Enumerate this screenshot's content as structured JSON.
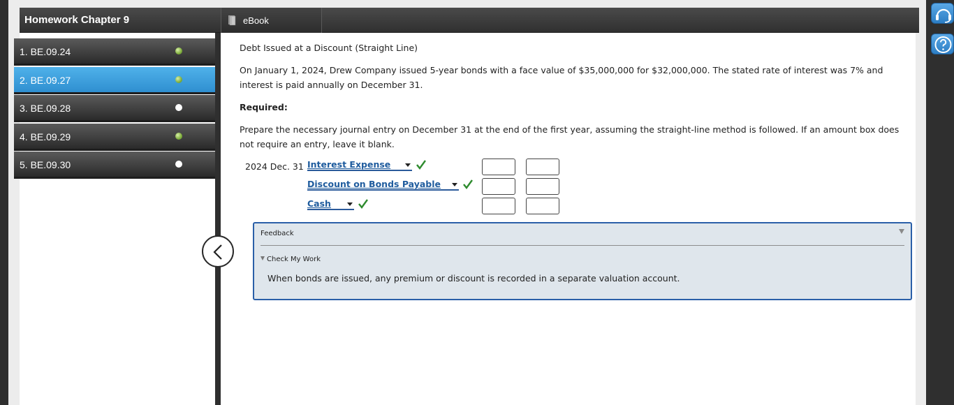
{
  "header": {
    "title": "Homework Chapter 9",
    "tab_ebook": "eBook"
  },
  "sidebar": {
    "items": [
      {
        "label": "1. BE.09.24",
        "status": "done"
      },
      {
        "label": "2. BE.09.27",
        "status": "done",
        "active": true
      },
      {
        "label": "3. BE.09.28",
        "status": "open"
      },
      {
        "label": "4. BE.09.29",
        "status": "done"
      },
      {
        "label": "5. BE.09.30",
        "status": "open"
      }
    ]
  },
  "question": {
    "heading": "Debt Issued at a Discount (Straight Line)",
    "paragraph1": "On January 1, 2024, Drew Company issued 5-year bonds with a face value of $35,000,000 for $32,000,000. The stated rate of interest was 7% and interest is paid annually on December 31.",
    "required_label": "Required:",
    "paragraph2": "Prepare the necessary journal entry on December 31 at the end of the first year, assuming the straight-line method is followed. If an amount box does not require an entry, leave it blank."
  },
  "journal": {
    "date": "2024 Dec. 31",
    "rows": [
      {
        "account": "Interest Expense",
        "debit": "",
        "credit": ""
      },
      {
        "account": "Discount on Bonds Payable",
        "debit": "",
        "credit": ""
      },
      {
        "account": "Cash",
        "debit": "",
        "credit": ""
      }
    ]
  },
  "feedback": {
    "title": "Feedback",
    "section": "Check My Work",
    "message": "When bonds are issued, any premium or discount is recorded in a separate valuation account."
  },
  "colors": {
    "active_item": "#2f8fd0",
    "link": "#1f5c9e",
    "check": "#2e8b2e",
    "feedback_border": "#2a5fa8"
  },
  "icons": {
    "ebook": "book-icon",
    "collapse": "chevron-left-icon",
    "support": "headset-icon",
    "help": "question-icon",
    "check": "checkmark-icon"
  }
}
